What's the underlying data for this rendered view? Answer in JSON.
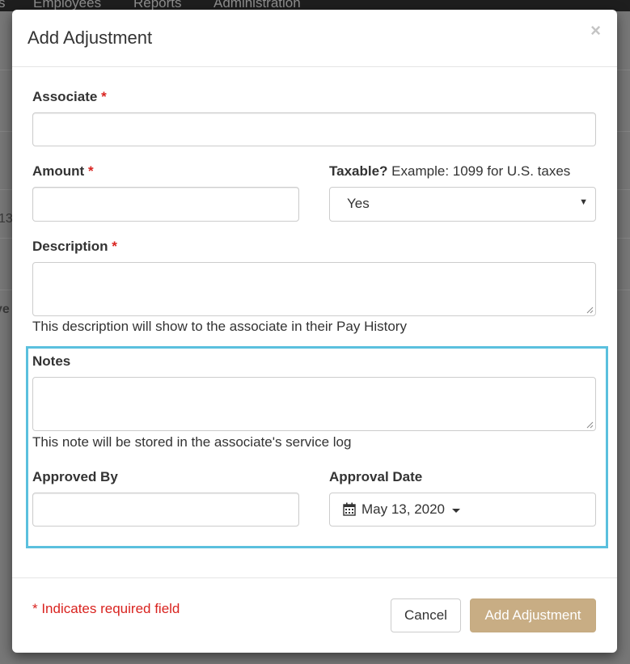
{
  "background": {
    "nav_items": [
      "s",
      "Employees",
      "Reports",
      "Administration"
    ],
    "fragments": [
      "13",
      "ve"
    ]
  },
  "modal": {
    "title": "Add Adjustment",
    "close_icon": "×",
    "fields": {
      "associate": {
        "label": "Associate",
        "required_mark": "*",
        "value": ""
      },
      "amount": {
        "label": "Amount",
        "required_mark": "*",
        "value": ""
      },
      "taxable": {
        "label": "Taxable?",
        "hint": "Example: 1099 for U.S. taxes",
        "selected": "Yes"
      },
      "description": {
        "label": "Description",
        "required_mark": "*",
        "value": "",
        "help": "This description will show to the associate in their Pay History"
      },
      "notes": {
        "label": "Notes",
        "value": "",
        "help": "This note will be stored in the associate's service log"
      },
      "approved_by": {
        "label": "Approved By",
        "value": ""
      },
      "approval_date": {
        "label": "Approval Date",
        "value": "May 13, 2020",
        "icon": "calendar-icon"
      }
    },
    "footer": {
      "required_note": "* Indicates required field",
      "cancel_label": "Cancel",
      "submit_label": "Add Adjustment"
    },
    "colors": {
      "required": "#d9231f",
      "highlight_border": "#5bc0de",
      "primary_button": "#c8ad84"
    }
  }
}
